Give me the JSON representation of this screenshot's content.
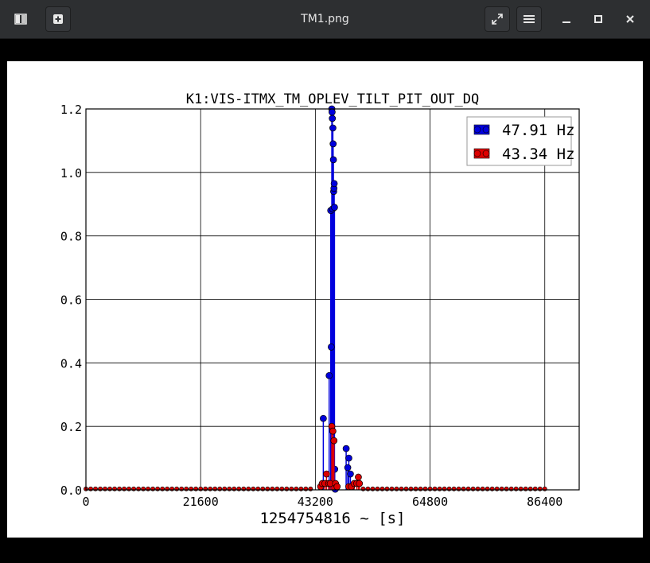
{
  "window": {
    "title": "TM1.png",
    "icons": [
      "sidebar-icon",
      "add-icon",
      "fullscreen-icon",
      "menu-icon",
      "minimize-icon",
      "maximize-icon",
      "close-icon"
    ]
  },
  "chart_data": {
    "type": "scatter",
    "style": "stem",
    "title": "K1:VIS-ITMX_TM_OPLEV_TILT_PIT_OUT_DQ",
    "xlabel": "1254754816 ~ [s]",
    "ylabel": "",
    "xlim": [
      0,
      92880
    ],
    "ylim": [
      0,
      1.2
    ],
    "xticks": [
      0,
      21600,
      43200,
      64800,
      86400
    ],
    "xtick_labels": [
      "0",
      "21600",
      "43200",
      "64800",
      "86400"
    ],
    "yticks": [
      0.0,
      0.2,
      0.4,
      0.6,
      0.8,
      1.0,
      1.2
    ],
    "ytick_labels": [
      "0.0",
      "0.2",
      "0.4",
      "0.6",
      "0.8",
      "1.0",
      "1.2"
    ],
    "grid": true,
    "legend_position": "top-right",
    "series": [
      {
        "name": "47.91 Hz",
        "color": "#0000dd",
        "x": [
          44700,
          45800,
          46100,
          46200,
          46300,
          46350,
          46400,
          46450,
          46500,
          46550,
          46600,
          46650,
          46700,
          46750,
          46800,
          46850,
          46900,
          46950,
          49000,
          49300,
          49500,
          49800
        ],
        "y": [
          0.225,
          0.36,
          0.88,
          0.45,
          1.2,
          1.19,
          1.17,
          0.885,
          1.14,
          1.09,
          1.04,
          0.94,
          0.95,
          0.965,
          0.89,
          0.065,
          0.003,
          0.002,
          0.13,
          0.07,
          0.1,
          0.05
        ]
      },
      {
        "name": "43.34 Hz",
        "color": "#dd0000",
        "x": [
          44200,
          44500,
          45000,
          45300,
          45700,
          46000,
          46300,
          46500,
          46700,
          47000,
          47300,
          49500,
          50000,
          50500,
          51000,
          51300,
          51500
        ],
        "y": [
          0.01,
          0.02,
          0.02,
          0.05,
          0.02,
          0.02,
          0.2,
          0.185,
          0.155,
          0.02,
          0.01,
          0.01,
          0.01,
          0.02,
          0.02,
          0.04,
          0.02
        ]
      }
    ]
  }
}
